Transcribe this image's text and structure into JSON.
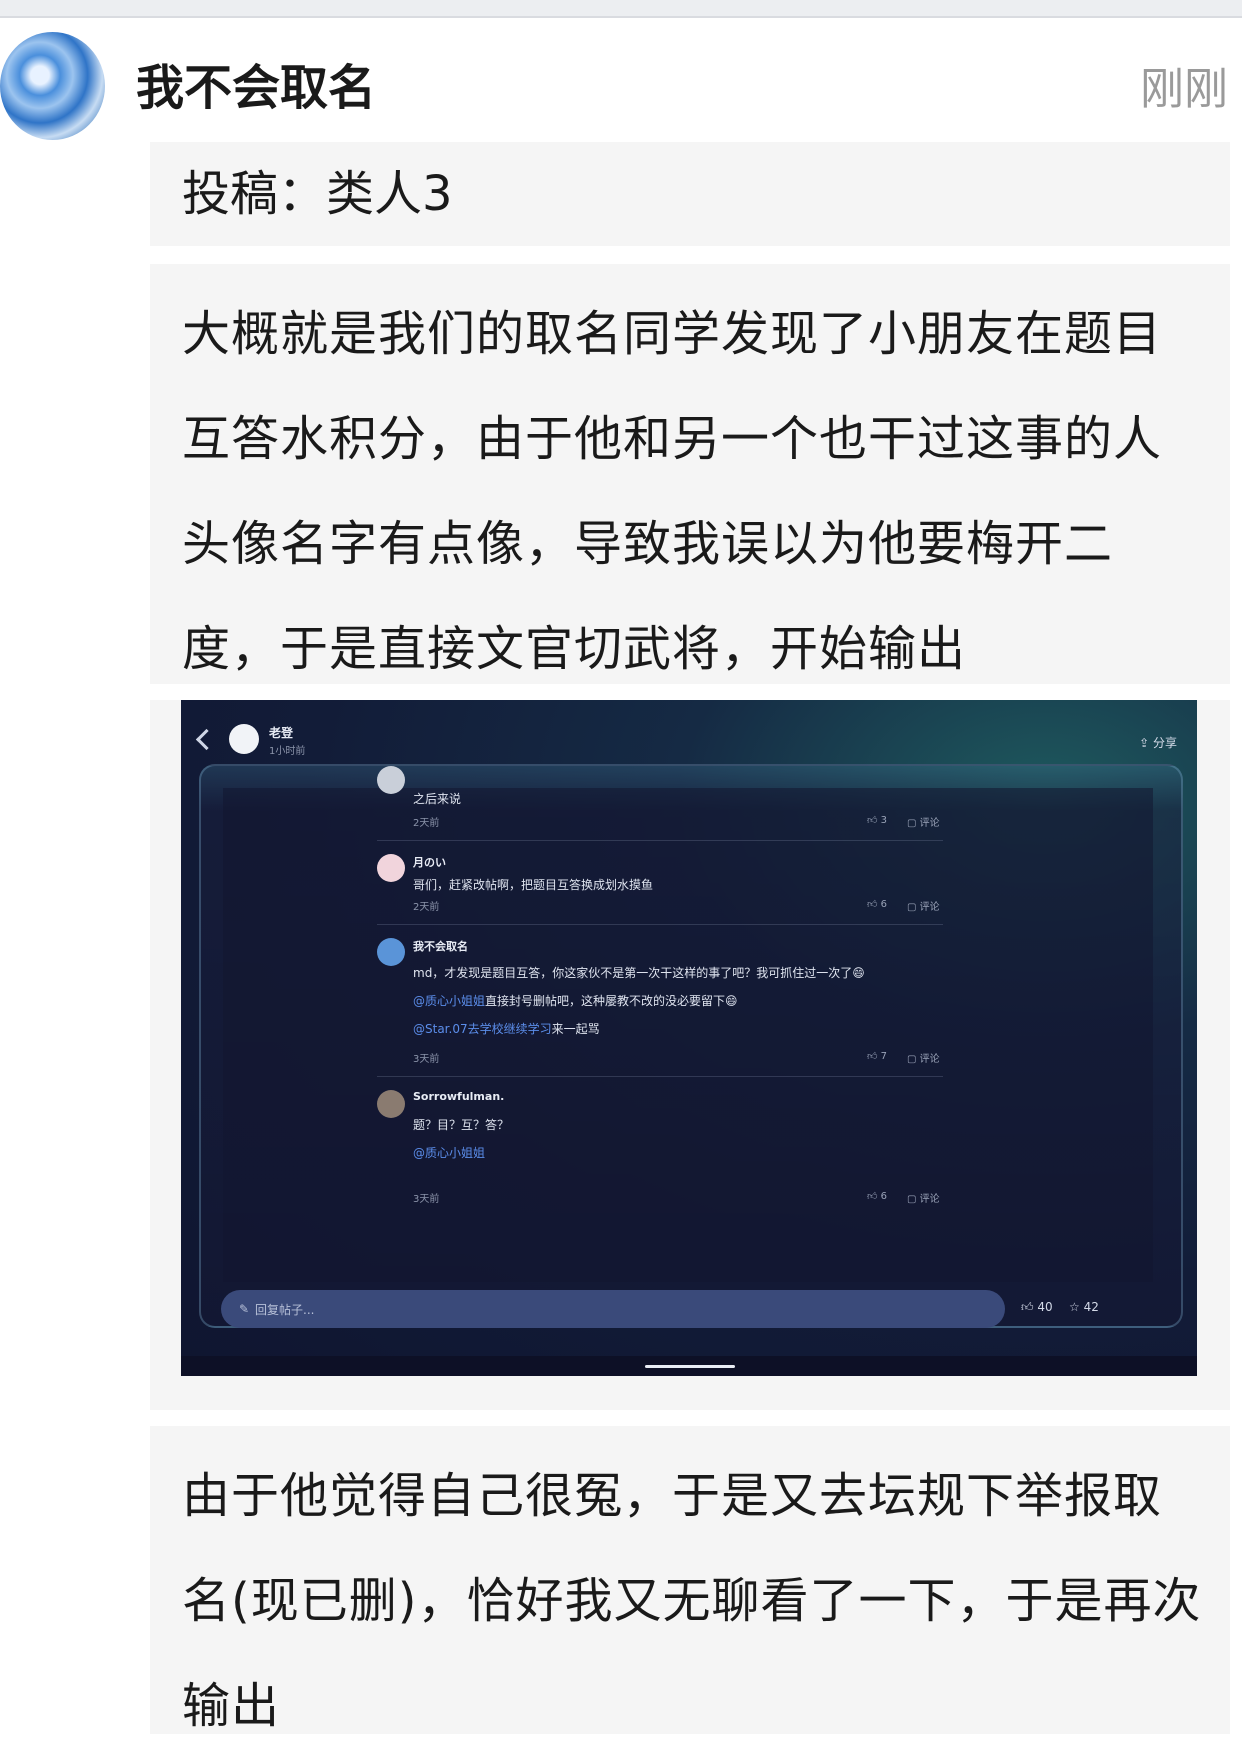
{
  "post": {
    "author": "我不会取名",
    "time": "刚刚",
    "title": "投稿：类人3",
    "paragraph1": "大概就是我们的取名同学发现了小朋友在题目互答水积分，由于他和另一个也干过这事的人头像名字有点像，导致我误以为他要梅开二度，于是直接文官切武将，开始输出",
    "paragraph2": "由于他觉得自己很冤，于是又去坛规下举报取名(现已删)，恰好我又无聊看了一下，于是再次输出"
  },
  "screenshot": {
    "header_title": "老登",
    "header_time": "1小时前",
    "share": "分享",
    "comments": [
      {
        "name": "",
        "lines": [
          "之后来说"
        ],
        "date": "2天前",
        "likes": "3",
        "comment": "评论",
        "avatar_color": "#c9cfd9"
      },
      {
        "name": "月のい",
        "lines": [
          "哥们，赶紧改帖啊，把题目互答换成划水摸鱼"
        ],
        "date": "2天前",
        "likes": "6",
        "comment": "评论",
        "avatar_color": "#f1d4dc"
      },
      {
        "name": "我不会取名",
        "line1": "md，才发现是题目互答，你这家伙不是第一次干这样的事了吧？我可抓住过一次了😄",
        "mention1": "@质心小姐姐",
        "line2": "直接封号删帖吧，这种屡教不改的没必要留下😄",
        "mention2": "@Star.07去学校继续学习",
        "line3": "来一起骂",
        "date": "3天前",
        "likes": "7",
        "comment": "评论",
        "avatar_color": "#5a94d8"
      },
      {
        "name": "Sorrowfulman.",
        "line1": "题？目？互？答？",
        "mention1": "@质心小姐姐",
        "date": "3天前",
        "likes": "6",
        "comment": "评论",
        "avatar_color": "#8a7b70"
      }
    ],
    "reply_placeholder": "回复帖子...",
    "total_likes": "40",
    "total_stars": "42"
  }
}
